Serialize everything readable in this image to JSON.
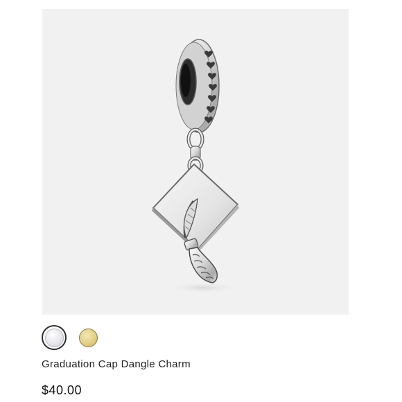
{
  "product": {
    "name": "Graduation Cap Dangle Charm",
    "price": "$40.00"
  },
  "wishlist": {
    "icon": "heart-outline-icon"
  },
  "swatches": [
    {
      "label": "silver",
      "color": "#e6e6ec",
      "selected": true
    },
    {
      "label": "gold",
      "color": "#e3cf87",
      "selected": false
    }
  ],
  "colors": {
    "image_background": "#f1f1f1",
    "text": "#222222"
  }
}
